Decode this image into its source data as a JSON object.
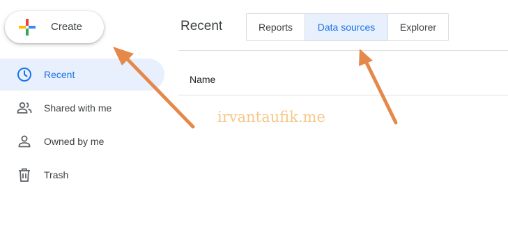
{
  "create_button": {
    "label": "Create",
    "icon": "google-plus-icon"
  },
  "sidebar": {
    "items": [
      {
        "label": "Recent",
        "icon": "clock-icon",
        "active": true
      },
      {
        "label": "Shared with me",
        "icon": "people-icon",
        "active": false
      },
      {
        "label": "Owned by me",
        "icon": "person-icon",
        "active": false
      },
      {
        "label": "Trash",
        "icon": "trash-icon",
        "active": false
      }
    ]
  },
  "header": {
    "title": "Recent",
    "tabs": [
      {
        "label": "Reports",
        "active": false
      },
      {
        "label": "Data sources",
        "active": true
      },
      {
        "label": "Explorer",
        "active": false
      }
    ]
  },
  "table": {
    "columns": [
      "Name"
    ]
  },
  "watermark": "irvantaufik.me",
  "colors": {
    "accent": "#1a73e8",
    "active_bg": "#e8f0fe",
    "annotation_arrow": "#e5894b",
    "watermark": "#f6c27d"
  }
}
